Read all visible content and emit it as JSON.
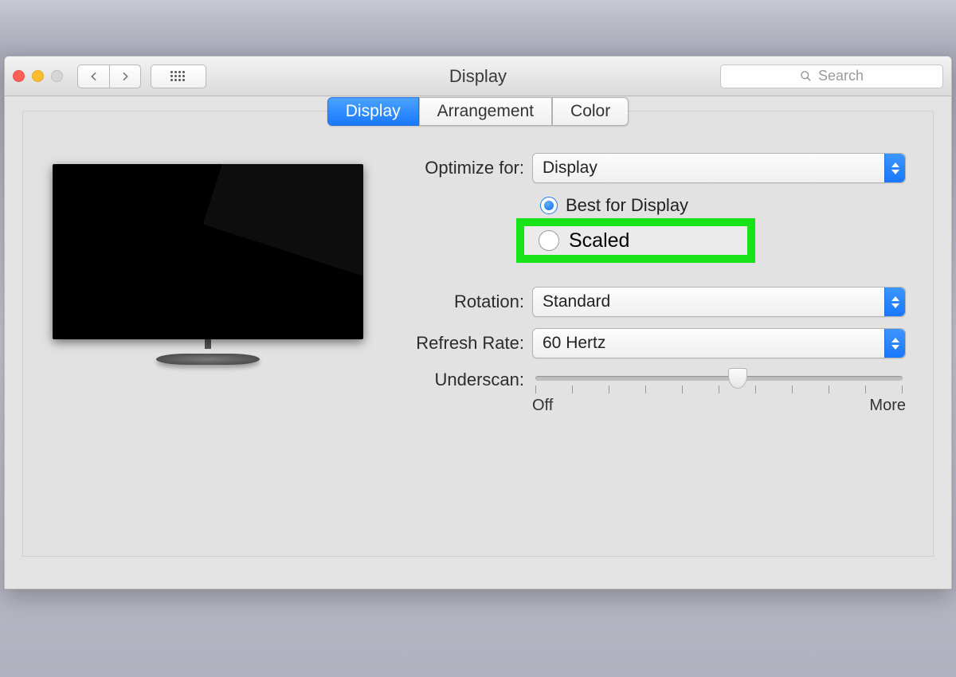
{
  "window": {
    "title": "Display"
  },
  "toolbar": {
    "search_placeholder": "Search"
  },
  "tabs": [
    {
      "label": "Display",
      "active": true
    },
    {
      "label": "Arrangement",
      "active": false
    },
    {
      "label": "Color",
      "active": false
    }
  ],
  "settings": {
    "optimize_label": "Optimize for:",
    "optimize_value": "Display",
    "resolution_options": {
      "best": "Best for Display",
      "scaled": "Scaled",
      "selected": "best",
      "highlighted": "scaled"
    },
    "rotation_label": "Rotation:",
    "rotation_value": "Standard",
    "refresh_label": "Refresh Rate:",
    "refresh_value": "60 Hertz",
    "underscan_label": "Underscan:",
    "underscan": {
      "min_label": "Off",
      "max_label": "More",
      "value_pct": 55,
      "ticks": 11
    }
  },
  "highlight_color": "#18e218"
}
